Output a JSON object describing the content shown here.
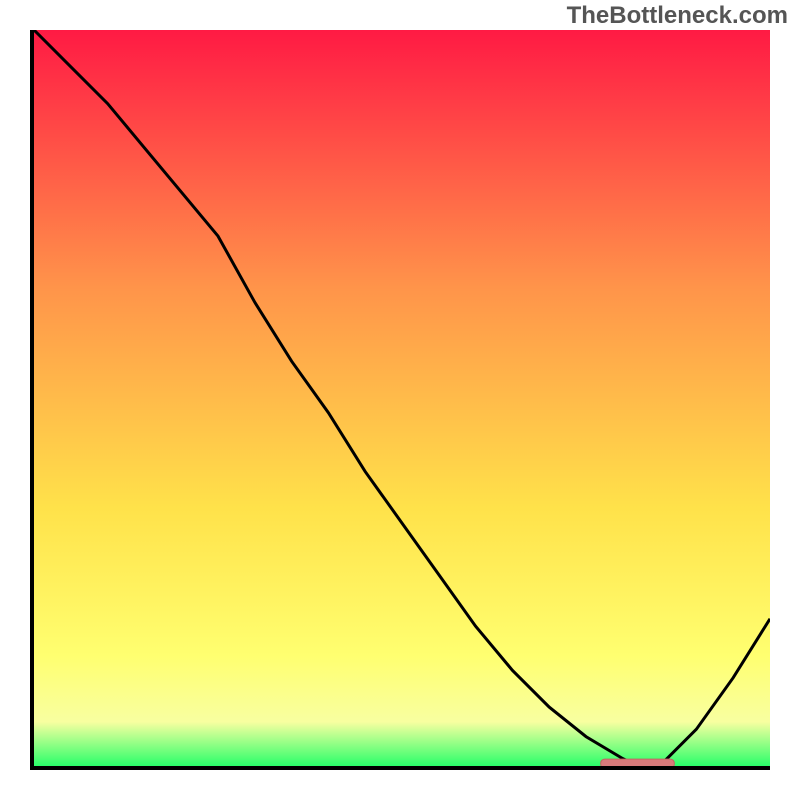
{
  "watermark": "TheBottleneck.com",
  "colors": {
    "axis": "#000000",
    "curve": "#000000",
    "marker_fill": "#d97b7b",
    "marker_stroke": "#c46363",
    "grad_top": "#ff1a44",
    "grad_mid1": "#ff944a",
    "grad_mid2": "#ffe24a",
    "grad_mid3": "#ffff70",
    "grad_mid4": "#f8ffa0",
    "grad_bottom": "#2aff6a"
  },
  "chart_data": {
    "type": "line",
    "title": "",
    "xlabel": "",
    "ylabel": "",
    "xlim": [
      0,
      100
    ],
    "ylim": [
      0,
      100
    ],
    "x": [
      0,
      5,
      10,
      15,
      20,
      25,
      30,
      35,
      40,
      45,
      50,
      55,
      60,
      65,
      70,
      75,
      80,
      82,
      85,
      90,
      95,
      100
    ],
    "values": [
      100,
      95,
      90,
      84,
      78,
      72,
      63,
      55,
      48,
      40,
      33,
      26,
      19,
      13,
      8,
      4,
      1,
      0,
      0,
      5,
      12,
      20
    ],
    "optimal_range_x": [
      77,
      87
    ],
    "optimal_y": 0.4
  }
}
